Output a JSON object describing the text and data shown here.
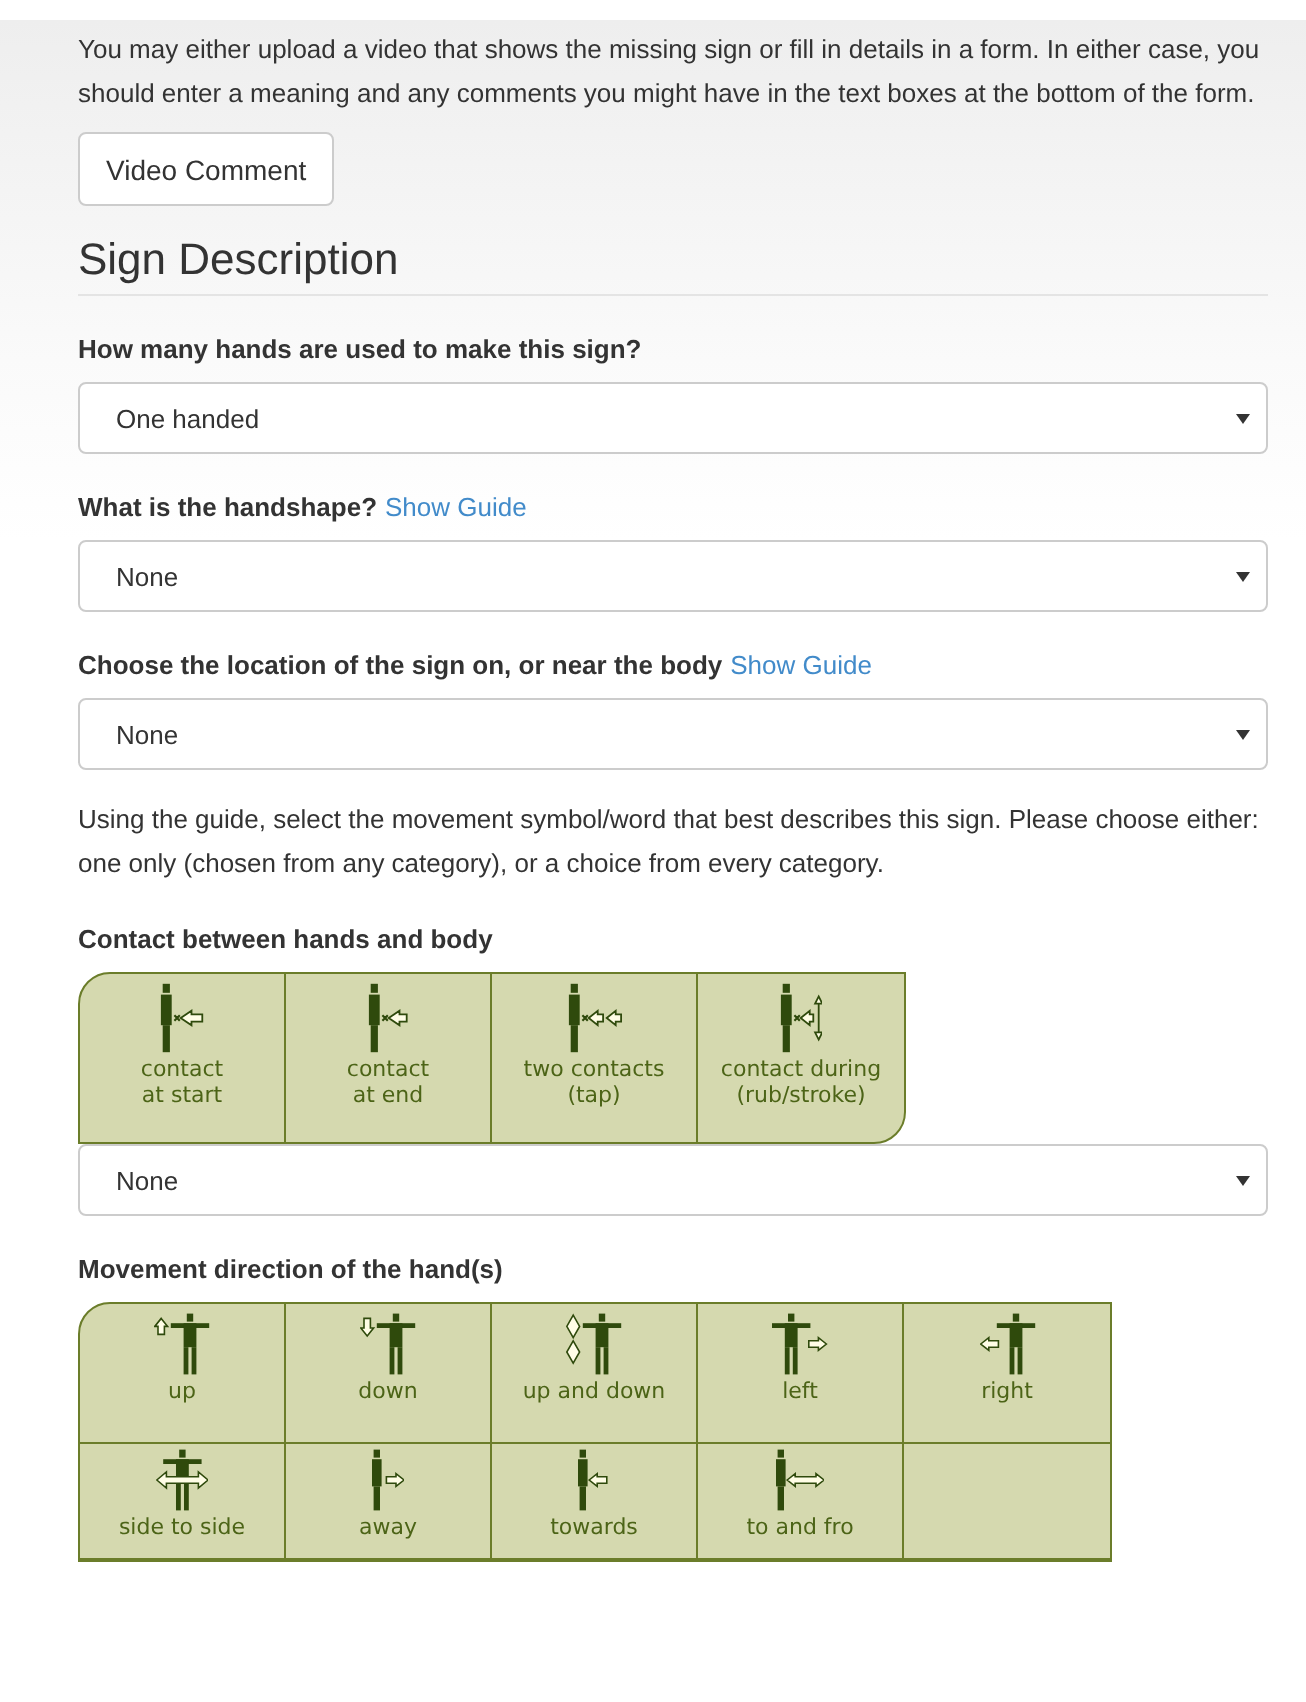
{
  "intro": "You may either upload a video that shows the missing sign or fill in details in a form. In either case, you should enter a meaning and any comments you might have in the text boxes at the bottom of the form.",
  "video_button": "Video Comment",
  "section_title": "Sign Description",
  "questions": [
    {
      "label": "How many hands are used to make this sign?",
      "value": "One handed"
    },
    {
      "label": "What is the handshape?",
      "link": "Show Guide",
      "value": "None"
    },
    {
      "label": "Choose the location of the sign on, or near the body",
      "link": "Show Guide",
      "value": "None"
    }
  ],
  "movement_note": "Using the guide, select the movement symbol/word that best describes this sign. Please choose either: one only (chosen from any category), or a choice from every category.",
  "contact": {
    "label": "Contact between hands and body",
    "value": "None",
    "cells": [
      {
        "line_1": "contact",
        "line_2": "at start"
      },
      {
        "line_1": "contact",
        "line_2": "at end"
      },
      {
        "line_1": "two contacts",
        "line_2": "(tap)"
      },
      {
        "line_1": "contact during",
        "line_2": "(rub/stroke)"
      }
    ]
  },
  "direction": {
    "label": "Movement direction of the hand(s)",
    "cells": [
      {
        "line_1": "up"
      },
      {
        "line_1": "down"
      },
      {
        "line_1": "up and down"
      },
      {
        "line_1": "left"
      },
      {
        "line_1": "right"
      },
      {
        "line_1": "side to side"
      },
      {
        "line_1": "away"
      },
      {
        "line_1": "towards"
      },
      {
        "line_1": "to and fro"
      }
    ]
  }
}
